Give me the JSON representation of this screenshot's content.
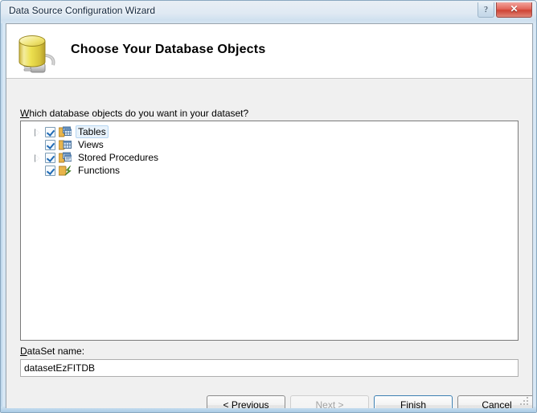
{
  "window": {
    "title": "Data Source Configuration Wizard",
    "help_button": "?",
    "close_button": "✕",
    "help_icon_name": "help-icon",
    "close_icon_name": "close-icon"
  },
  "banner": {
    "heading": "Choose Your Database Objects",
    "icon": "database-plug-icon"
  },
  "main": {
    "prompt_underlined": "W",
    "prompt_rest": "hich database objects do you want in your dataset?",
    "tree": {
      "nodes": [
        {
          "label": "Tables",
          "checked": true,
          "expandable": true,
          "selected": true,
          "icon": "tables-icon"
        },
        {
          "label": "Views",
          "checked": true,
          "expandable": false,
          "selected": false,
          "icon": "views-icon"
        },
        {
          "label": "Stored Procedures",
          "checked": true,
          "expandable": true,
          "selected": false,
          "icon": "stored-procedures-icon"
        },
        {
          "label": "Functions",
          "checked": true,
          "expandable": false,
          "selected": false,
          "icon": "functions-icon"
        }
      ]
    },
    "dataset": {
      "label_underlined": "D",
      "label_rest": "ataSet name:",
      "value": "datasetEzFITDB",
      "placeholder": ""
    }
  },
  "footer": {
    "buttons": [
      {
        "label": "< Previous",
        "underline": "P",
        "state": "enabled",
        "name": "previous-button"
      },
      {
        "label": "Next >",
        "underline": "N",
        "state": "disabled",
        "name": "next-button"
      },
      {
        "label": "Finish",
        "underline": "F",
        "state": "default",
        "name": "finish-button"
      },
      {
        "label": "Cancel",
        "underline": "",
        "state": "enabled",
        "name": "cancel-button"
      }
    ]
  },
  "colors": {
    "accent_blue": "#3c7fb1",
    "close_red": "#cf4334",
    "banner_bg": "#ffffff",
    "dialog_bg": "#f0f0f0",
    "selection_blue": "#e8f2fb"
  }
}
